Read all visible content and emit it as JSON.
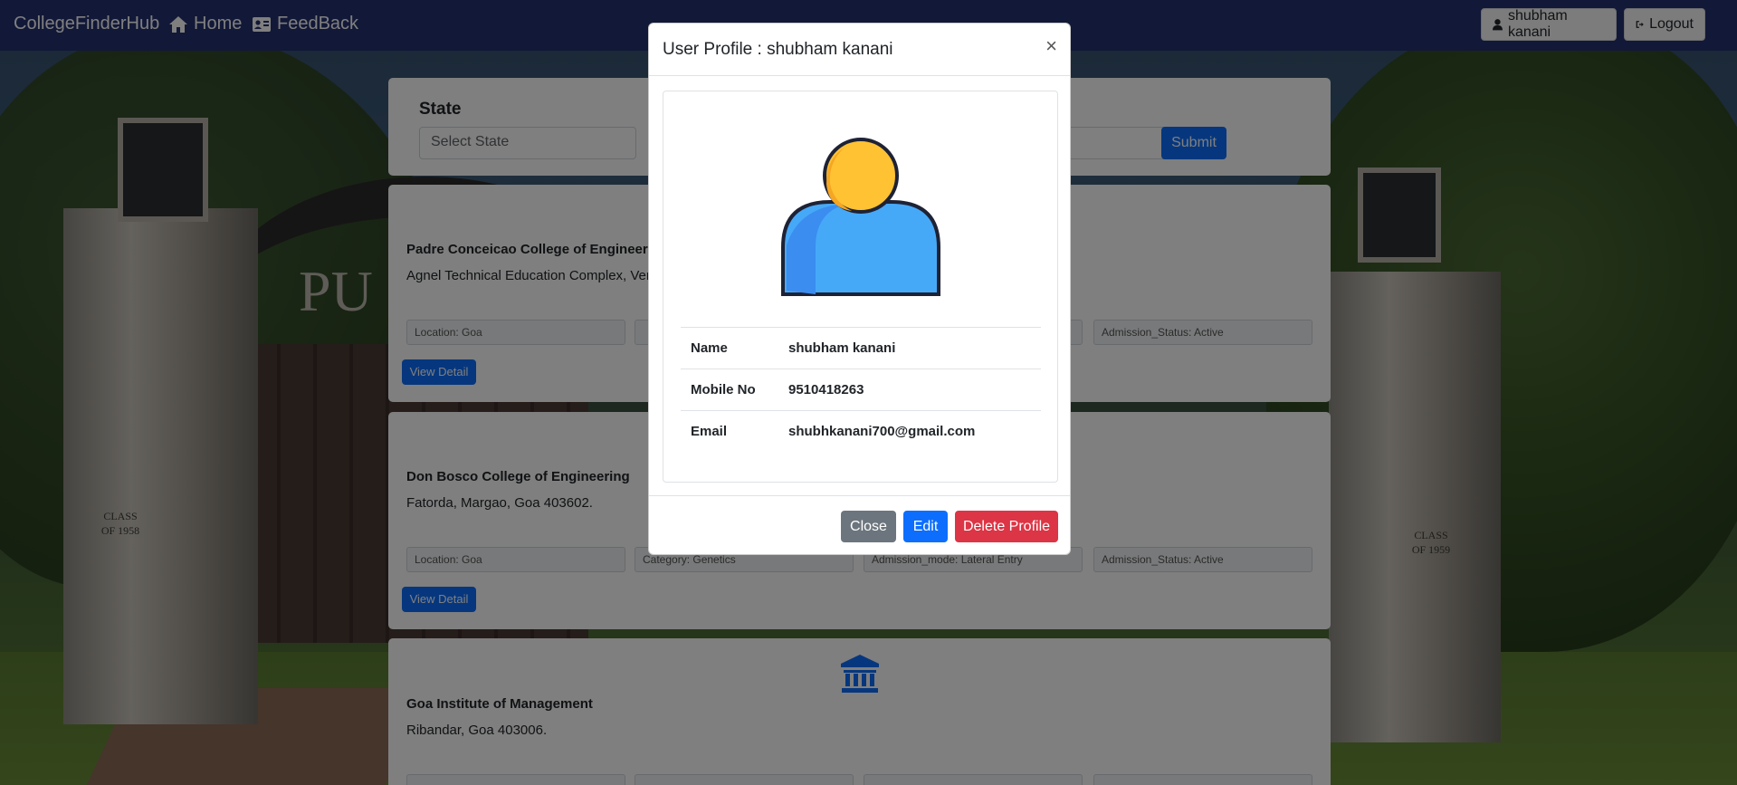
{
  "navbar": {
    "brand": "CollegeFinderHub",
    "home_label": "Home",
    "feedback_label": "FeedBack",
    "user_label": "shubham kanani",
    "logout_label": "Logout"
  },
  "filter": {
    "state_label": "State",
    "state_placeholder": "Select State",
    "submit_label": "Submit"
  },
  "colleges": [
    {
      "name": "Padre Conceicao College of Engineering",
      "address": "Agnel Technical Education Complex, Verna",
      "location": "Location: Goa",
      "category": "",
      "admission_mode": "",
      "admission_status": "Admission_Status: Active",
      "detail_label": "View Detail"
    },
    {
      "name": "Don Bosco College of Engineering",
      "address": "Fatorda, Margao, Goa 403602.",
      "location": "Location: Goa",
      "category": "Category: Genetics",
      "admission_mode": "Admission_mode: Lateral Entry",
      "admission_status": "Admission_Status: Active",
      "detail_label": "View Detail"
    },
    {
      "name": "Goa Institute of Management",
      "address": "Ribandar, Goa 403006."
    }
  ],
  "modal": {
    "title": "User Profile : shubham kanani",
    "close_symbol": "×",
    "fields": [
      {
        "key": "Name",
        "value": "shubham kanani"
      },
      {
        "key": "Mobile No",
        "value": "9510418263"
      },
      {
        "key": "Email",
        "value": "shubhkanani700@gmail.com"
      }
    ],
    "close_label": "Close",
    "edit_label": "Edit",
    "delete_label": "Delete Profile"
  },
  "background": {
    "plaque_left": "CLASS OF 1958",
    "plaque_right": "CLASS OF 1959",
    "arch_text": "PU"
  },
  "colors": {
    "navbar": "#24306e",
    "primary": "#0d6efd",
    "secondary": "#6c757d",
    "danger": "#dc3545",
    "avatar_head": "#fec233",
    "avatar_body": "#46a9f8"
  },
  "icons": [
    "home-icon",
    "id-card-icon",
    "user-icon",
    "sign-out-icon",
    "university-icon",
    "user-avatar-icon"
  ]
}
